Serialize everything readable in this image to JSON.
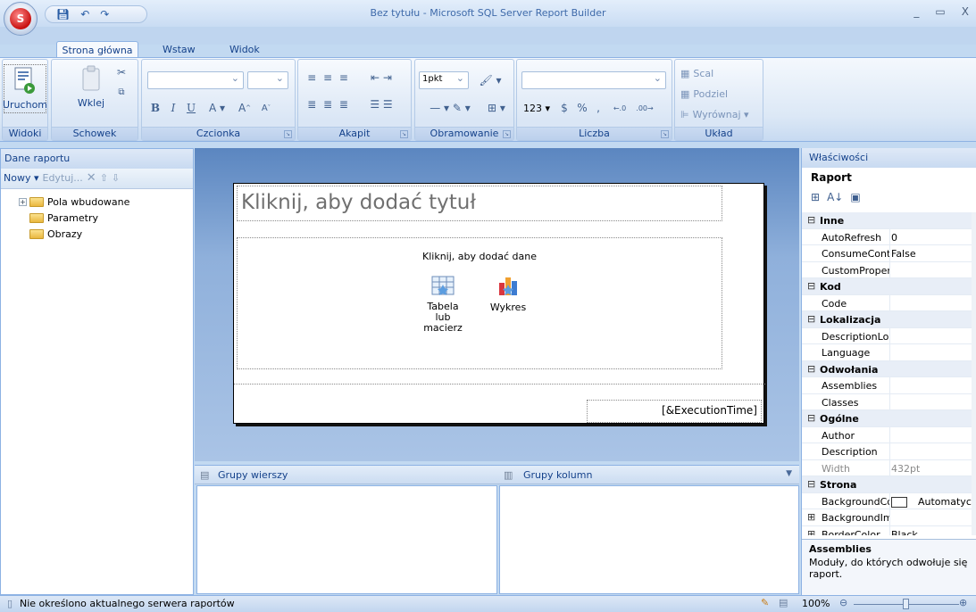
{
  "window": {
    "title": "Bez tytułu - Microsoft SQL Server Report Builder",
    "minimize": "_",
    "maximize": "▭",
    "close": "X"
  },
  "qat": {
    "save_icon": "save-icon",
    "undo_icon": "undo-icon",
    "redo_icon": "redo-icon"
  },
  "tabs": [
    {
      "label": "Strona główna",
      "active": true
    },
    {
      "label": "Wstaw",
      "active": false
    },
    {
      "label": "Widok",
      "active": false
    }
  ],
  "ribbon": {
    "groups": {
      "views": "Widoki",
      "clipboard": "Schowek",
      "font": "Czcionka",
      "paragraph": "Akapit",
      "border": "Obramowanie",
      "number": "Liczba",
      "layout": "Układ"
    },
    "run_label": "Uruchom",
    "paste_label": "Wklej",
    "border_width": "1pkt",
    "number_123": "123",
    "merge_label": "Scal",
    "split_label": "Podziel",
    "align_label": "Wyrównaj"
  },
  "left_panel": {
    "title": "Dane raportu",
    "toolbar": {
      "new": "Nowy",
      "edit": "Edytuj..."
    },
    "tree": [
      {
        "label": "Pola wbudowane",
        "expandable": true
      },
      {
        "label": "Parametry",
        "expandable": false
      },
      {
        "label": "Obrazy",
        "expandable": false
      }
    ]
  },
  "report": {
    "title_placeholder": "Kliknij, aby dodać tytuł",
    "data_prompt": "Kliknij, aby dodać dane",
    "table_label": "Tabela lub macierz",
    "chart_label": "Wykres",
    "footer_expr": "[&ExecutionTime]"
  },
  "grouping": {
    "rows": "Grupy wierszy",
    "columns": "Grupy kolumn"
  },
  "properties": {
    "title": "Właściwości",
    "object": "Raport",
    "rows": [
      {
        "type": "cat",
        "name": "Inne",
        "sign": "⊟"
      },
      {
        "type": "prop",
        "name": "AutoRefresh",
        "value": "0"
      },
      {
        "type": "prop",
        "name": "ConsumeConta",
        "value": "False"
      },
      {
        "type": "prop",
        "name": "CustomPropert",
        "value": ""
      },
      {
        "type": "cat",
        "name": "Kod",
        "sign": "⊟"
      },
      {
        "type": "prop",
        "name": "Code",
        "value": ""
      },
      {
        "type": "cat",
        "name": "Lokalizacja",
        "sign": "⊟"
      },
      {
        "type": "prop",
        "name": "DescriptionLo",
        "value": ""
      },
      {
        "type": "prop",
        "name": "Language",
        "value": ""
      },
      {
        "type": "cat",
        "name": "Odwołania",
        "sign": "⊟"
      },
      {
        "type": "prop",
        "name": "Assemblies",
        "value": ""
      },
      {
        "type": "prop",
        "name": "Classes",
        "value": ""
      },
      {
        "type": "cat",
        "name": "Ogólne",
        "sign": "⊟"
      },
      {
        "type": "prop",
        "name": "Author",
        "value": ""
      },
      {
        "type": "prop",
        "name": "Description",
        "value": ""
      },
      {
        "type": "prop",
        "name": "Width",
        "value": "432pt",
        "dim": true
      },
      {
        "type": "cat",
        "name": "Strona",
        "sign": "⊟"
      },
      {
        "type": "prop",
        "name": "BackgroundCo",
        "value": "Automatyczn",
        "swatch": true
      },
      {
        "type": "prop",
        "name": "BackgroundIm",
        "value": "",
        "expand": "⊞"
      },
      {
        "type": "prop",
        "name": "BorderColor",
        "value": "Black",
        "expand": "⊞"
      }
    ],
    "help_title": "Assemblies",
    "help_text": "Moduły, do których odwołuje się raport."
  },
  "status": {
    "message": "Nie określono aktualnego serwera raportów",
    "zoom": "100%"
  }
}
